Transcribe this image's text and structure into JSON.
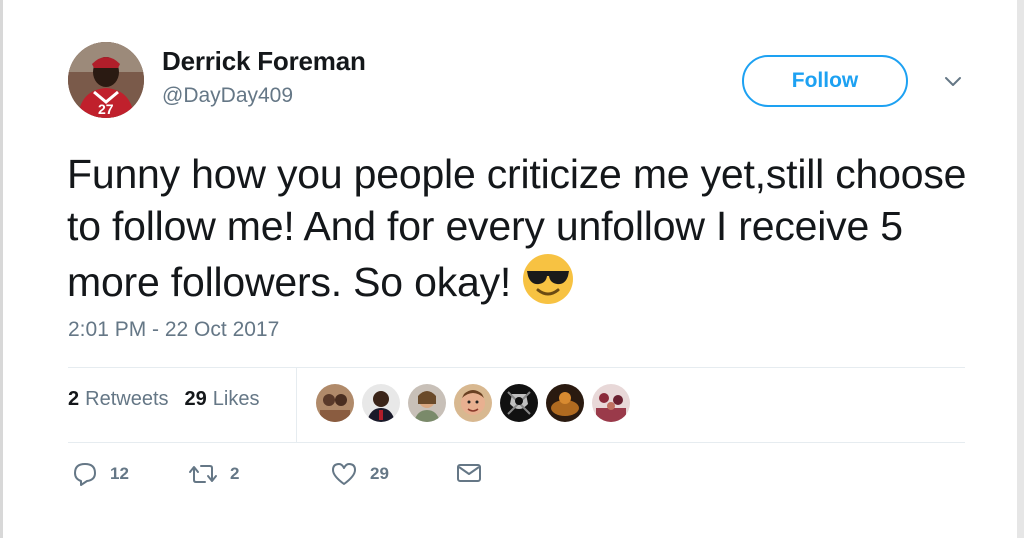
{
  "tweet": {
    "author": {
      "display_name": "Derrick Foreman",
      "handle": "@DayDay409"
    },
    "follow_label": "Follow",
    "text": "Funny how you people criticize me yet,still choose to follow me! And for every unfollow I receive 5 more followers. So okay!",
    "emoji": "smiling-face-with-sunglasses",
    "timestamp": "2:01 PM - 22 Oct 2017"
  },
  "stats": {
    "retweets_count": "2",
    "retweets_label": "Retweets",
    "likes_count": "29",
    "likes_label": "Likes"
  },
  "actions": {
    "reply_count": "12",
    "retweet_count": "2",
    "like_count": "29"
  },
  "colors": {
    "accent": "#1da1f2",
    "secondary_text": "#657786",
    "primary_text": "#14171a"
  },
  "icons": [
    "chevron-down-icon",
    "reply-icon",
    "retweet-icon",
    "heart-icon",
    "direct-message-icon"
  ]
}
